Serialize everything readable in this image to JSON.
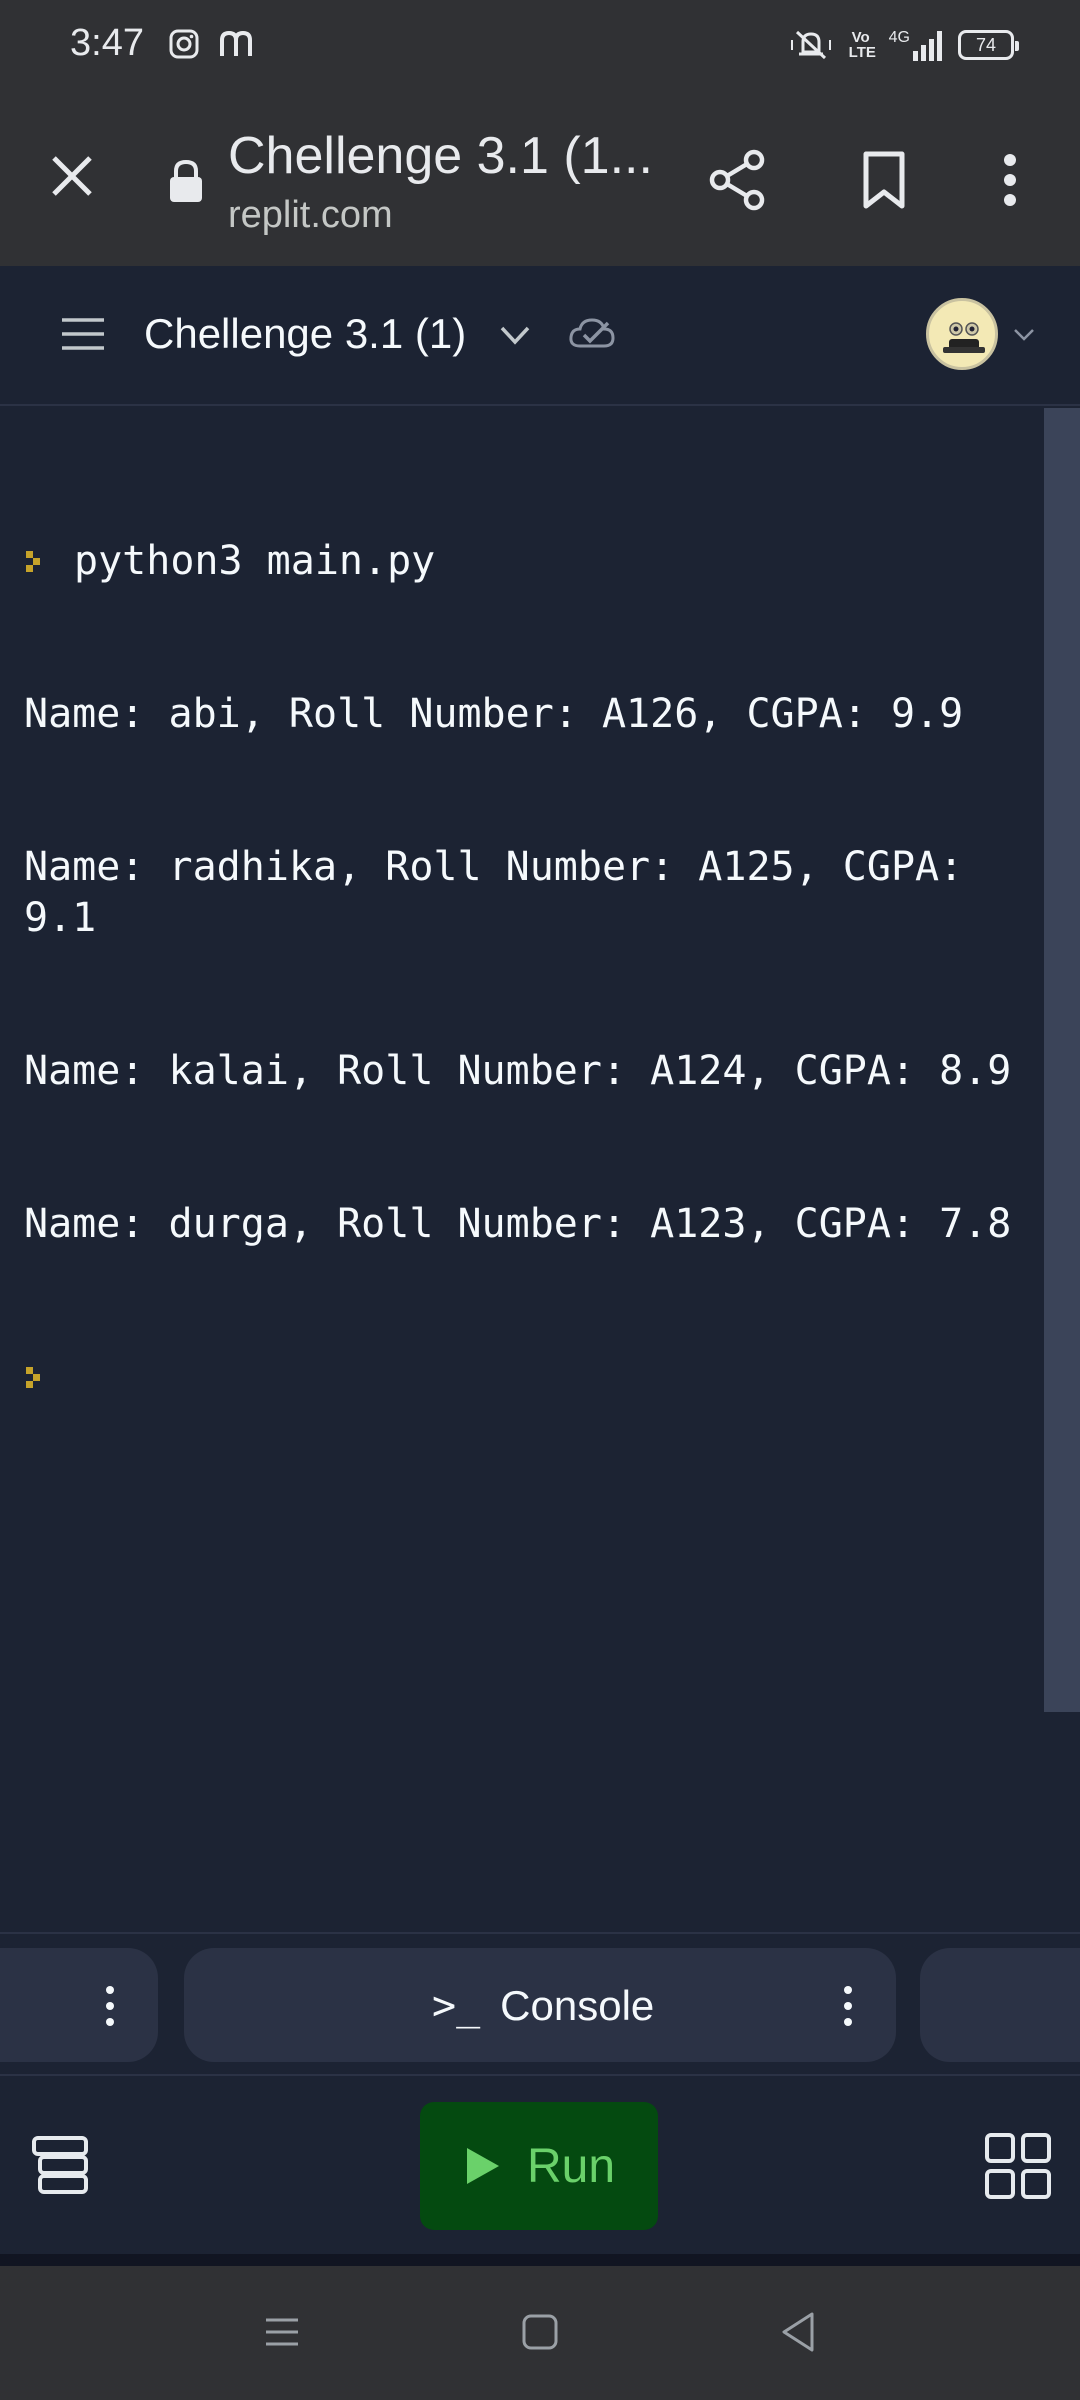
{
  "status_bar": {
    "time": "3:47",
    "battery": "74",
    "left_icons": [
      "instagram-icon",
      "threads-icon"
    ],
    "right_icons": [
      "mute-vibrate-icon",
      "volte-icon",
      "signal-4g-icon",
      "battery-icon"
    ],
    "volte_label": "Vo LTE",
    "network_label": "4G"
  },
  "browser": {
    "title": "Chellenge 3.1 (1...",
    "url": "replit.com"
  },
  "repl_header": {
    "title": "Chellenge 3.1 (1)"
  },
  "console": {
    "command": "python3 main.py",
    "output": [
      "Name: abi, Roll Number: A126, CGPA: 9.9",
      "Name: radhika, Roll Number: A125, CGPA: 9.1",
      "Name: kalai, Roll Number: A124, CGPA: 8.9",
      "Name: durga, Roll Number: A123, CGPA: 7.8"
    ]
  },
  "tabs": {
    "console_label": "Console"
  },
  "actions": {
    "run_label": "Run"
  },
  "colors": {
    "background": "#1c2333",
    "prompt": "#c6a32a",
    "run_bg": "#044a10",
    "run_fg": "#6ad16a"
  }
}
